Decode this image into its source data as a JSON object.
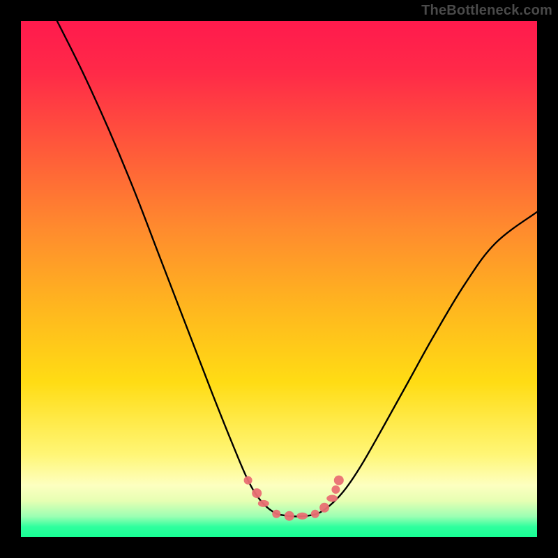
{
  "attribution": "TheBottleneck.com",
  "colors": {
    "background": "#000000",
    "gradient_top": "#ff1a4d",
    "gradient_mid1": "#ff8a2e",
    "gradient_mid2": "#ffdc14",
    "gradient_pale": "#fdffc0",
    "gradient_green": "#17ff95",
    "curve_stroke": "#000000",
    "marker_fill": "#e96f73",
    "attribution_text": "#4a4a4a"
  },
  "chart_data": {
    "type": "line",
    "title": "",
    "xlabel": "",
    "ylabel": "",
    "x_range_pct": [
      0,
      100
    ],
    "y_range_pct": [
      0,
      100
    ],
    "note": "Axes are unlabeled; coordinates given as percent of the 740×740 plot area, origin top-left. Curve is a V-shaped bottleneck profile: steep descent from top-left, flat trough ~49–58% x near bottom, rise toward upper-right at ~37% y.",
    "series": [
      {
        "name": "bottleneck-curve",
        "xy_pct": [
          [
            7.0,
            0.0
          ],
          [
            12.0,
            10.0
          ],
          [
            17.0,
            21.0
          ],
          [
            22.0,
            33.0
          ],
          [
            27.0,
            46.0
          ],
          [
            32.0,
            59.0
          ],
          [
            37.0,
            72.0
          ],
          [
            41.0,
            82.0
          ],
          [
            44.0,
            89.0
          ],
          [
            46.5,
            93.0
          ],
          [
            49.0,
            95.2
          ],
          [
            51.0,
            95.8
          ],
          [
            53.5,
            96.0
          ],
          [
            56.0,
            95.8
          ],
          [
            58.0,
            95.2
          ],
          [
            60.5,
            93.3
          ],
          [
            63.0,
            90.5
          ],
          [
            66.0,
            86.0
          ],
          [
            70.0,
            79.0
          ],
          [
            75.0,
            70.0
          ],
          [
            80.0,
            61.0
          ],
          [
            86.0,
            51.0
          ],
          [
            92.0,
            43.0
          ],
          [
            100.0,
            37.0
          ]
        ]
      },
      {
        "name": "highlight-markers",
        "style": "salmon-blobs",
        "xy_pct": [
          [
            44.0,
            89.0
          ],
          [
            45.7,
            91.5
          ],
          [
            47.0,
            93.5
          ],
          [
            49.5,
            95.5
          ],
          [
            52.0,
            95.9
          ],
          [
            54.5,
            95.9
          ],
          [
            57.0,
            95.5
          ],
          [
            58.8,
            94.3
          ],
          [
            60.3,
            92.5
          ],
          [
            61.0,
            90.8
          ],
          [
            61.6,
            89.0
          ]
        ]
      }
    ]
  }
}
